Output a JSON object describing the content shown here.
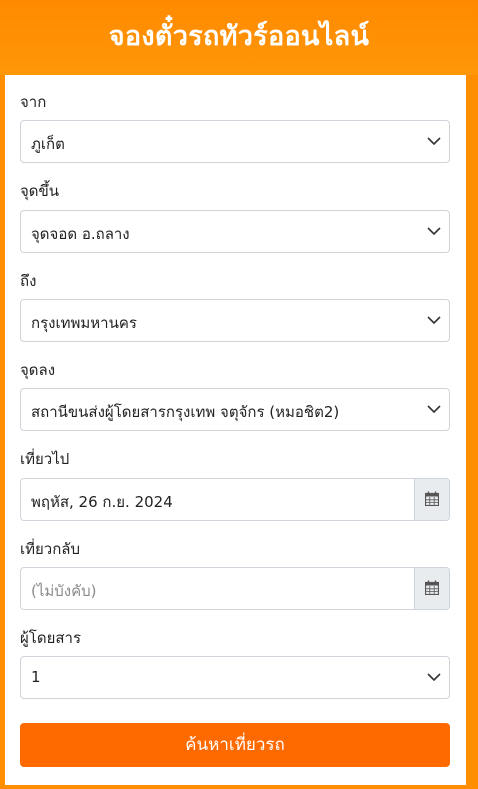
{
  "header": {
    "title": "จองตั๋วรถทัวร์ออนไลน์"
  },
  "form": {
    "from": {
      "label": "จาก",
      "value": "ภูเก็ต"
    },
    "pickup": {
      "label": "จุดขึ้น",
      "value": "จุดจอด อ.ถลาง"
    },
    "to": {
      "label": "ถึง",
      "value": "กรุงเทพมหานคร"
    },
    "dropoff": {
      "label": "จุดลง",
      "value": "สถานีขนส่งผู้โดยสารกรุงเทพ จตุจักร (หมอชิต2)"
    },
    "depart": {
      "label": "เที่ยวไป",
      "value": "พฤหัส, 26 ก.ย. 2024"
    },
    "return": {
      "label": "เที่ยวกลับ",
      "placeholder": "(ไม่บังคับ)"
    },
    "passengers": {
      "label": "ผู้โดยสาร",
      "value": "1"
    },
    "submit_label": "ค้นหาเที่ยวรถ"
  },
  "colors": {
    "brand_orange": "#ff8f00",
    "button_orange": "#ff6a00"
  }
}
